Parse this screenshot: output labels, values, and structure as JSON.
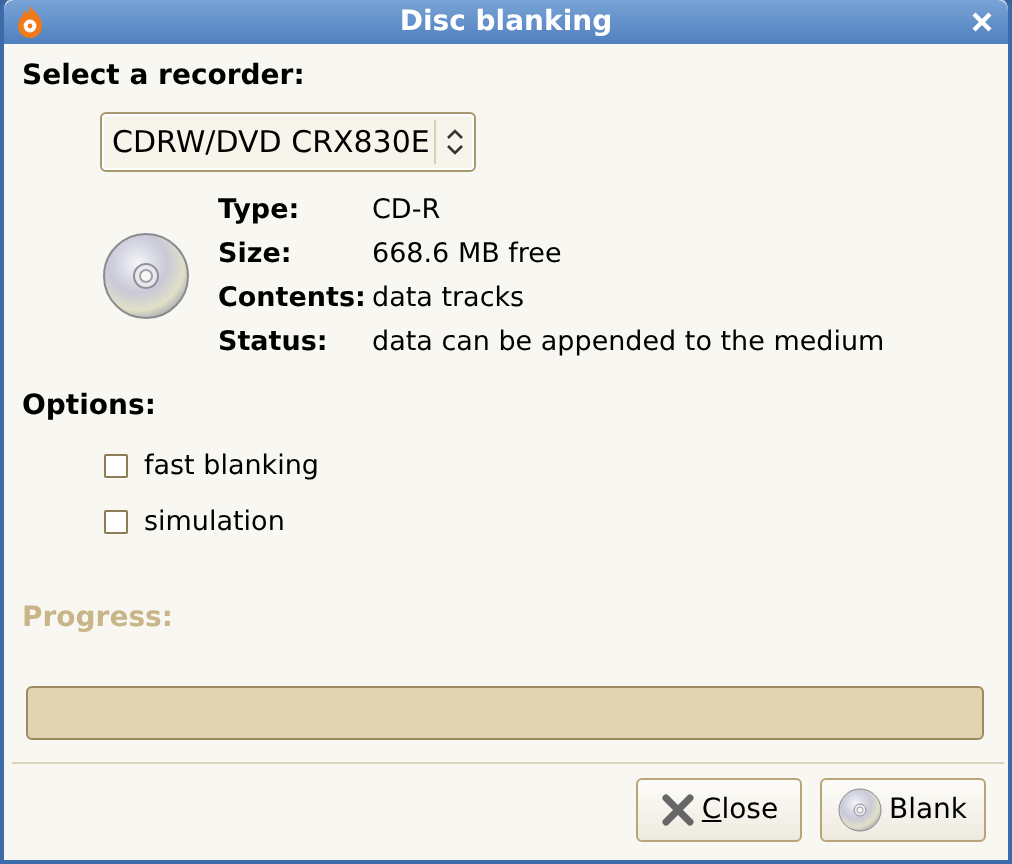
{
  "window": {
    "title": "Disc blanking"
  },
  "recorder": {
    "label": "Select a recorder:",
    "value": "CDRW/DVD CRX830E"
  },
  "medium_info": [
    {
      "label": "Type:",
      "value": "CD-R"
    },
    {
      "label": "Size:",
      "value": "668.6 MB free"
    },
    {
      "label": "Contents:",
      "value": "data tracks"
    },
    {
      "label": "Status:",
      "value": "data can be appended to the medium"
    }
  ],
  "options": {
    "label": "Options:",
    "items": [
      {
        "label": "fast blanking",
        "checked": false
      },
      {
        "label": "simulation",
        "checked": false
      }
    ]
  },
  "progress": {
    "label": "Progress:",
    "disabled": true,
    "level": 0
  },
  "buttons": [
    {
      "label": "Close",
      "kind": "close"
    },
    {
      "label": "Blank",
      "kind": "blank"
    }
  ]
}
